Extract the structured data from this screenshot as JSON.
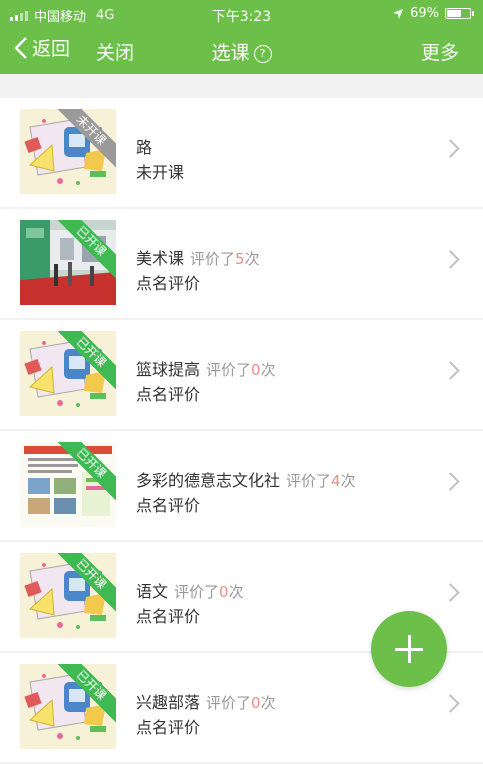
{
  "status_bar": {
    "carrier": "中国移动",
    "network": "4G",
    "time": "下午3:23",
    "battery": "69%",
    "battery_level": 0.69
  },
  "nav": {
    "back_label": "返回",
    "close_label": "关闭",
    "title": "选课",
    "help_symbol": "?",
    "more_label": "更多"
  },
  "courses": [
    {
      "name": "路",
      "subtitle": "未开课",
      "badge": "未开课",
      "badge_state": "not-started",
      "thumbnail": "school-supplies-illustration",
      "eval_prefix": "",
      "eval_count": "",
      "eval_suffix": ""
    },
    {
      "name": "美术课",
      "subtitle": "点名评价",
      "badge": "已开课",
      "badge_state": "started",
      "thumbnail": "exhibition-photo",
      "eval_prefix": "评价了",
      "eval_count": "5",
      "eval_suffix": "次"
    },
    {
      "name": "篮球提高",
      "subtitle": "点名评价",
      "badge": "已开课",
      "badge_state": "started",
      "thumbnail": "school-supplies-illustration",
      "eval_prefix": "评价了",
      "eval_count": "0",
      "eval_suffix": "次"
    },
    {
      "name": "多彩的德意志文化社",
      "subtitle": "点名评价",
      "badge": "已开课",
      "badge_state": "started",
      "thumbnail": "poster-flyer",
      "eval_prefix": "评价了",
      "eval_count": "4",
      "eval_suffix": "次"
    },
    {
      "name": "语文",
      "subtitle": "点名评价",
      "badge": "已开课",
      "badge_state": "started",
      "thumbnail": "school-supplies-illustration",
      "eval_prefix": "评价了",
      "eval_count": "0",
      "eval_suffix": "次"
    },
    {
      "name": "兴趣部落",
      "subtitle": "点名评价",
      "badge": "已开课",
      "badge_state": "started",
      "thumbnail": "school-supplies-illustration",
      "eval_prefix": "评价了",
      "eval_count": "0",
      "eval_suffix": "次"
    }
  ],
  "fab": {
    "icon": "plus-icon"
  },
  "colors": {
    "brand": "#6cc04a",
    "badge_started": "#3fba52",
    "badge_not_started": "#9a9a9a",
    "eval_count": "#f08c8c"
  }
}
